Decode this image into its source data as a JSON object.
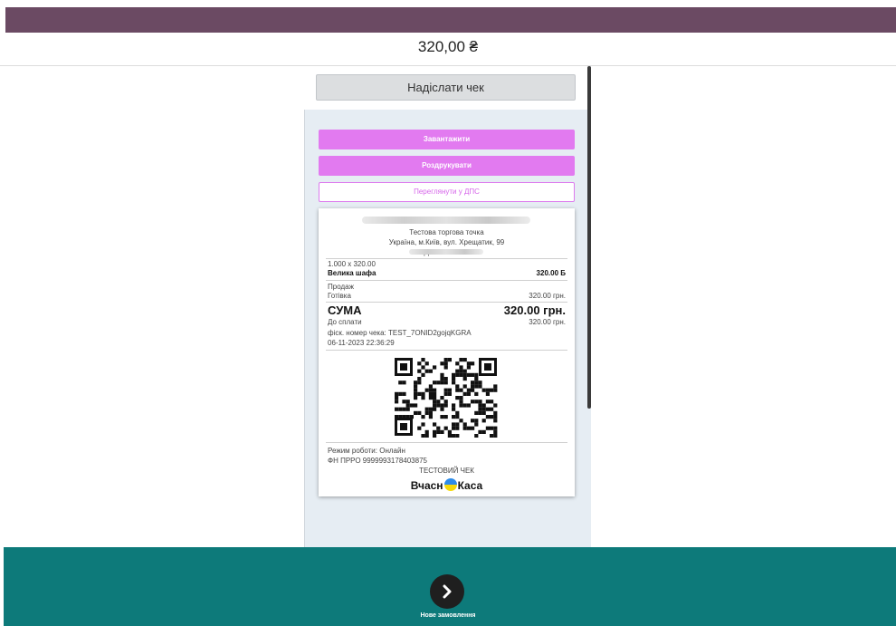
{
  "header": {
    "total": "320,00 ₴"
  },
  "panel": {
    "send_receipt_label": "Надіслати чек",
    "download_label": "Завантажити",
    "print_label": "Роздрукувати",
    "view_dps_label": "Переглянути у ДПС"
  },
  "receipt": {
    "shop_name": "Тестова торгова точка",
    "address": "Україна, м.Київ, вул. Хрещатик, 99",
    "id_label": "ІД 2478492075",
    "qty_price": "1.000 x 320.00",
    "item_name": "Велика шафа",
    "item_sum": "320.00 Б",
    "operation": "Продаж",
    "payment_type": "Готівка",
    "payment_sum": "320.00 грн.",
    "total_label": "СУМА",
    "total_value": "320.00 грн.",
    "to_pay_label": "До сплати",
    "to_pay_value": "320.00 грн.",
    "fiscal_number": "фіск. номер чека: TEST_7ONID2gojqKGRA",
    "datetime": "06-11-2023 22:36:29",
    "mode": "Режим роботи: Онлайн",
    "prro": "ФН ПРРО 9999993178403875",
    "test_label": "ТЕСТОВИЙ ЧЕК",
    "brand_left": "Вчасн",
    "brand_right": "Каса"
  },
  "footer": {
    "new_order_label": "Нове замовлення"
  },
  "colors": {
    "topbar": "#6b4a63",
    "accent": "#e27af0",
    "footer": "#0d7a7a"
  },
  "icons": {
    "next": "chevron-right-icon",
    "qr": "qr-code-icon"
  }
}
